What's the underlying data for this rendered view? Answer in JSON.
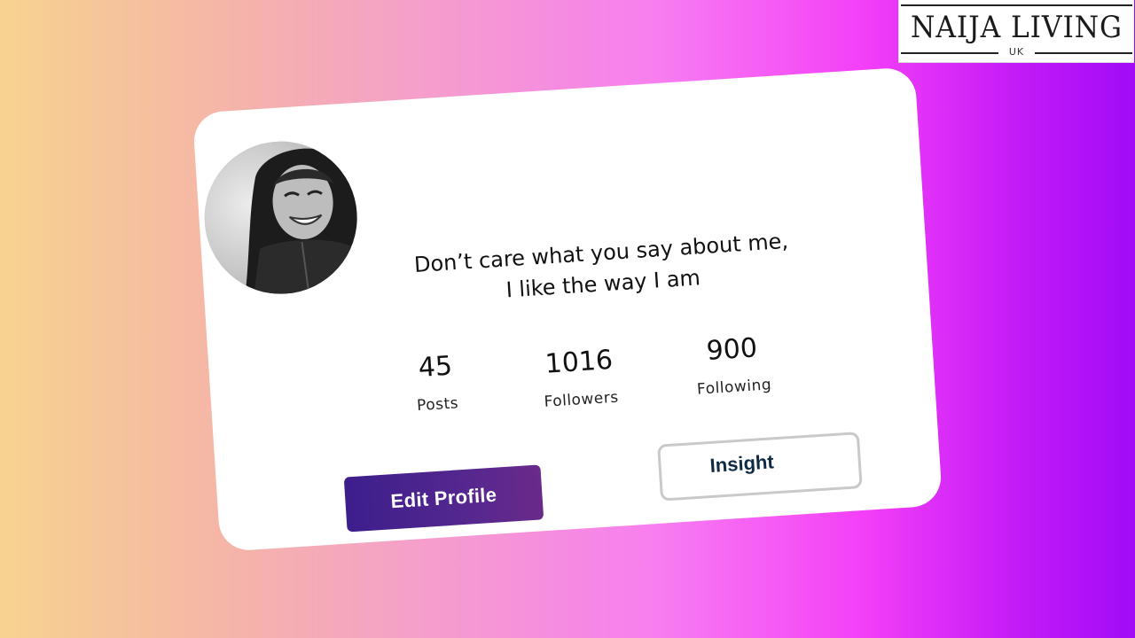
{
  "logo": {
    "name": "NAIJA LIVING",
    "sub": "UK"
  },
  "profile": {
    "bio_line1": "Don’t care what you say about me,",
    "bio_line2": "I like the way I am",
    "stats": {
      "posts": {
        "value": "45",
        "label": "Posts"
      },
      "followers": {
        "value": "1016",
        "label": "Followers"
      },
      "following": {
        "value": "900",
        "label": "Following"
      }
    },
    "buttons": {
      "edit": "Edit Profile",
      "insight": "Insight"
    }
  },
  "colors": {
    "edit_button": "#3c1e8c",
    "insight_text": "#0f2b44",
    "background_left": "#f7d38f",
    "background_right": "#a10bf7"
  }
}
